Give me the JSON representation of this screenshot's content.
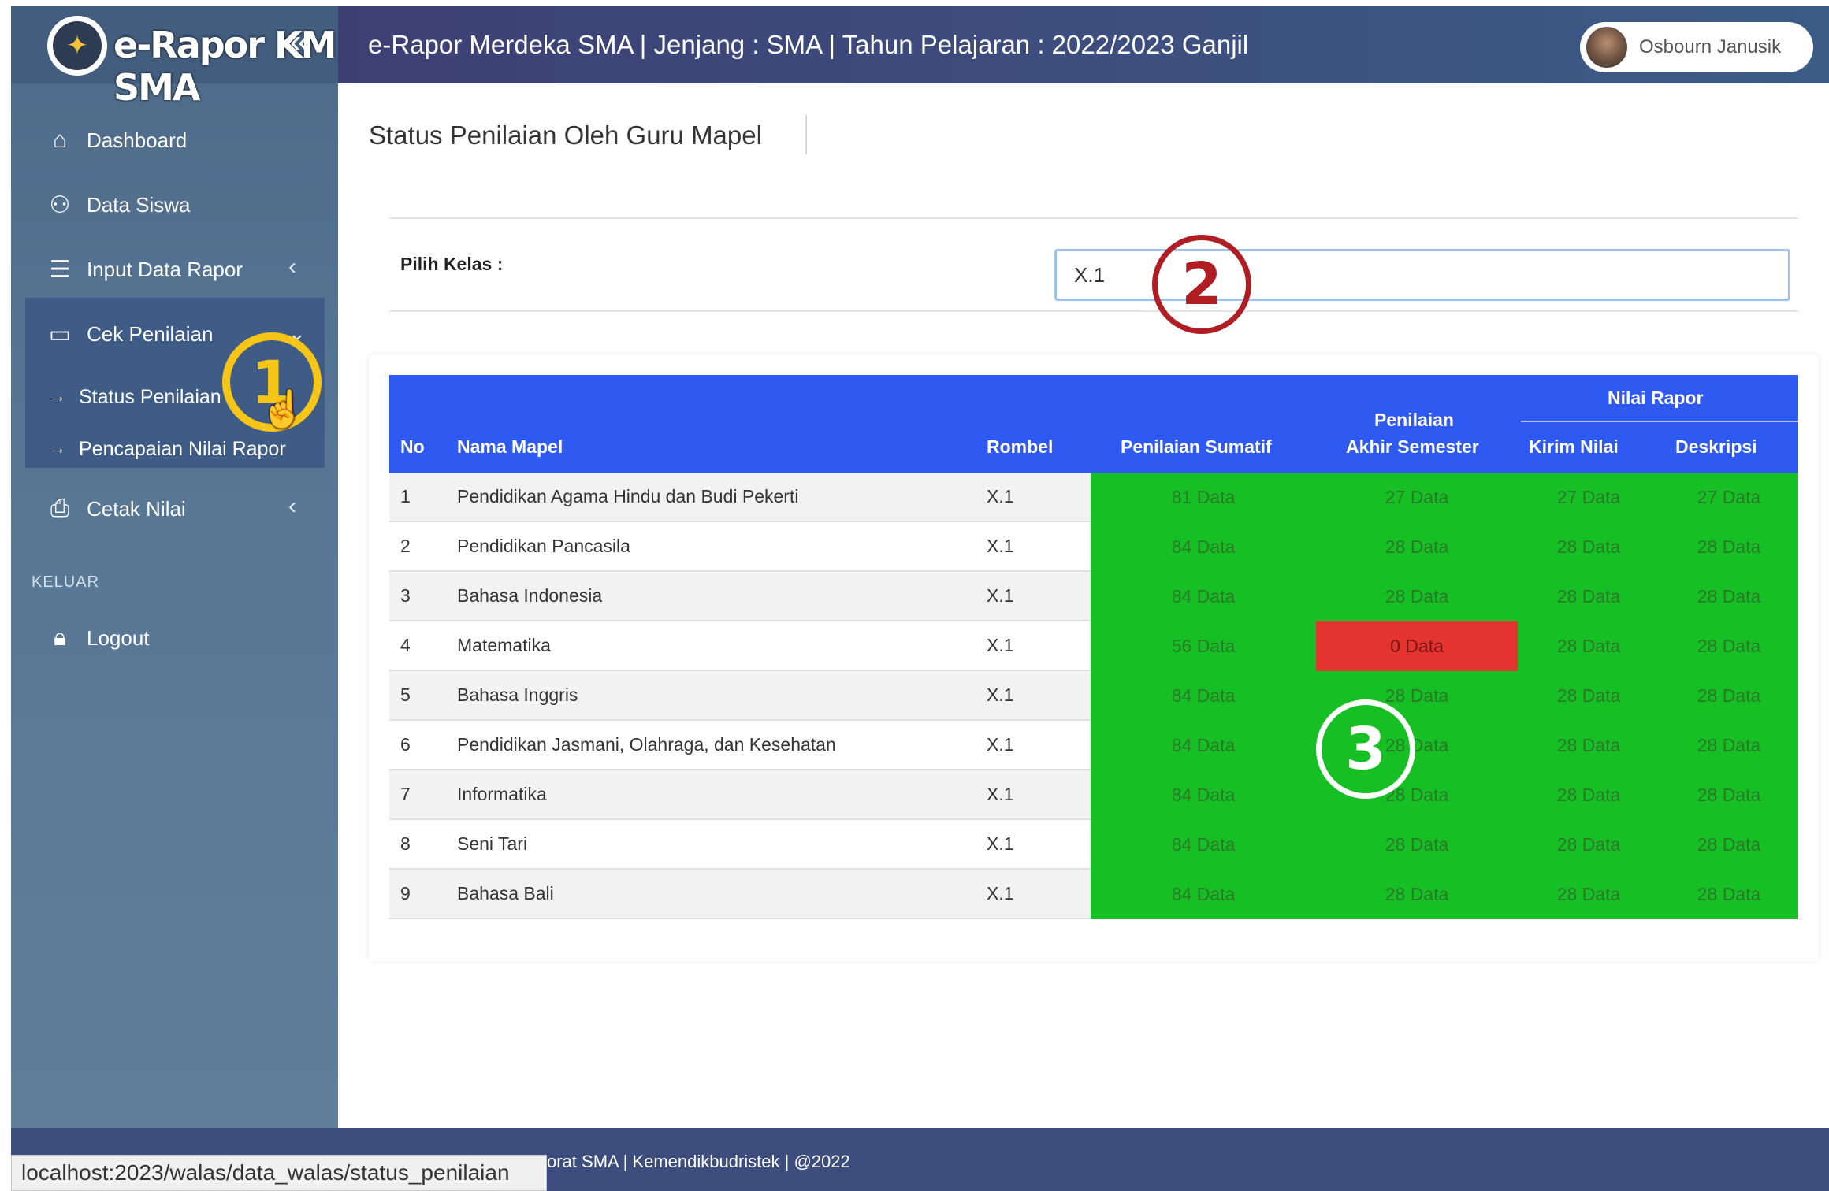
{
  "brand": {
    "title": "e-Rapor KM SMA"
  },
  "sidebar": {
    "items": [
      {
        "label": "Dashboard",
        "icon": "home-icon"
      },
      {
        "label": "Data Siswa",
        "icon": "users-icon"
      },
      {
        "label": "Input Data Rapor",
        "icon": "list-icon"
      },
      {
        "label": "Cek Penilaian",
        "icon": "inbox-icon"
      },
      {
        "label": "Cetak Nilai",
        "icon": "printer-icon"
      }
    ],
    "subitems": [
      {
        "label": "Status Penilaian"
      },
      {
        "label": "Pencapaian Nilai Rapor"
      }
    ],
    "section_label": "KELUAR",
    "logout_label": "Logout"
  },
  "header": {
    "title": "e-Rapor Merdeka SMA | Jenjang : SMA | Tahun Pelajaran : 2022/2023 Ganjil",
    "user_name": "Osbourn Janusik"
  },
  "main": {
    "page_title": "Status Penilaian Oleh Guru Mapel",
    "pilih_kelas_label": "Pilih Kelas :",
    "kelas_value": "X.1",
    "table": {
      "headers": {
        "no": "No",
        "nama_mapel": "Nama Mapel",
        "rombel": "Rombel",
        "sumatif": "Penilaian Sumatif",
        "pas_line1": "Penilaian",
        "pas_line2": "Akhir Semester",
        "nilai_rapor": "Nilai Rapor",
        "kirim_nilai": "Kirim Nilai",
        "deskripsi": "Deskripsi"
      },
      "rows": [
        {
          "no": "1",
          "mapel": "Pendidikan Agama Hindu dan Budi Pekerti",
          "rombel": "X.1",
          "sumatif": "81 Data",
          "pas": "27 Data",
          "kirim": "27 Data",
          "deskripsi": "27 Data"
        },
        {
          "no": "2",
          "mapel": "Pendidikan Pancasila",
          "rombel": "X.1",
          "sumatif": "84 Data",
          "pas": "28 Data",
          "kirim": "28 Data",
          "deskripsi": "28 Data"
        },
        {
          "no": "3",
          "mapel": "Bahasa Indonesia",
          "rombel": "X.1",
          "sumatif": "84 Data",
          "pas": "28 Data",
          "kirim": "28 Data",
          "deskripsi": "28 Data"
        },
        {
          "no": "4",
          "mapel": "Matematika",
          "rombel": "X.1",
          "sumatif": "56 Data",
          "pas": "0 Data",
          "kirim": "28 Data",
          "deskripsi": "28 Data"
        },
        {
          "no": "5",
          "mapel": "Bahasa Inggris",
          "rombel": "X.1",
          "sumatif": "84 Data",
          "pas": "28 Data",
          "kirim": "28 Data",
          "deskripsi": "28 Data"
        },
        {
          "no": "6",
          "mapel": "Pendidikan Jasmani, Olahraga, dan Kesehatan",
          "rombel": "X.1",
          "sumatif": "84 Data",
          "pas": "28 Data",
          "kirim": "28 Data",
          "deskripsi": "28 Data"
        },
        {
          "no": "7",
          "mapel": "Informatika",
          "rombel": "X.1",
          "sumatif": "84 Data",
          "pas": "28 Data",
          "kirim": "28 Data",
          "deskripsi": "28 Data"
        },
        {
          "no": "8",
          "mapel": "Seni Tari",
          "rombel": "X.1",
          "sumatif": "84 Data",
          "pas": "28 Data",
          "kirim": "28 Data",
          "deskripsi": "28 Data"
        },
        {
          "no": "9",
          "mapel": "Bahasa Bali",
          "rombel": "X.1",
          "sumatif": "84 Data",
          "pas": "28 Data",
          "kirim": "28 Data",
          "deskripsi": "28 Data"
        }
      ]
    }
  },
  "annotations": {
    "one": "1",
    "two": "2",
    "three": "3"
  },
  "footer": {
    "text": "orat SMA | Kemendikbudristek | @2022"
  },
  "statusbar": {
    "url": "localhost:2023/walas/data_walas/status_penilaian"
  },
  "colors": {
    "complete": "#16c024",
    "missing": "#e3342f",
    "header_blue": "#2f5af2"
  }
}
